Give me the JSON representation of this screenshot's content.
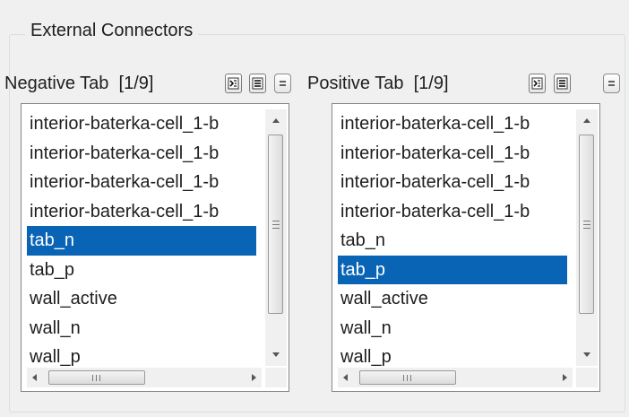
{
  "group": {
    "title": "External Connectors"
  },
  "negative": {
    "label": "Negative Tab",
    "count": "[1/9]",
    "items": [
      "interior-baterka-cell_1-b",
      "interior-baterka-cell_1-b",
      "interior-baterka-cell_1-b",
      "interior-baterka-cell_1-b",
      "tab_n",
      "tab_p",
      "wall_active",
      "wall_n",
      "wall_p"
    ],
    "selected_index": 4
  },
  "positive": {
    "label": "Positive Tab",
    "count": "[1/9]",
    "items": [
      "interior-baterka-cell_1-b",
      "interior-baterka-cell_1-b",
      "interior-baterka-cell_1-b",
      "interior-baterka-cell_1-b",
      "tab_n",
      "tab_p",
      "wall_active",
      "wall_n",
      "wall_p"
    ],
    "selected_index": 5
  },
  "icons": {
    "toolbar": [
      "select-all-icon",
      "deselect-all-icon",
      "filter-icon"
    ]
  },
  "colors": {
    "selection": "#0a64b5",
    "background": "#f0f0f0"
  }
}
